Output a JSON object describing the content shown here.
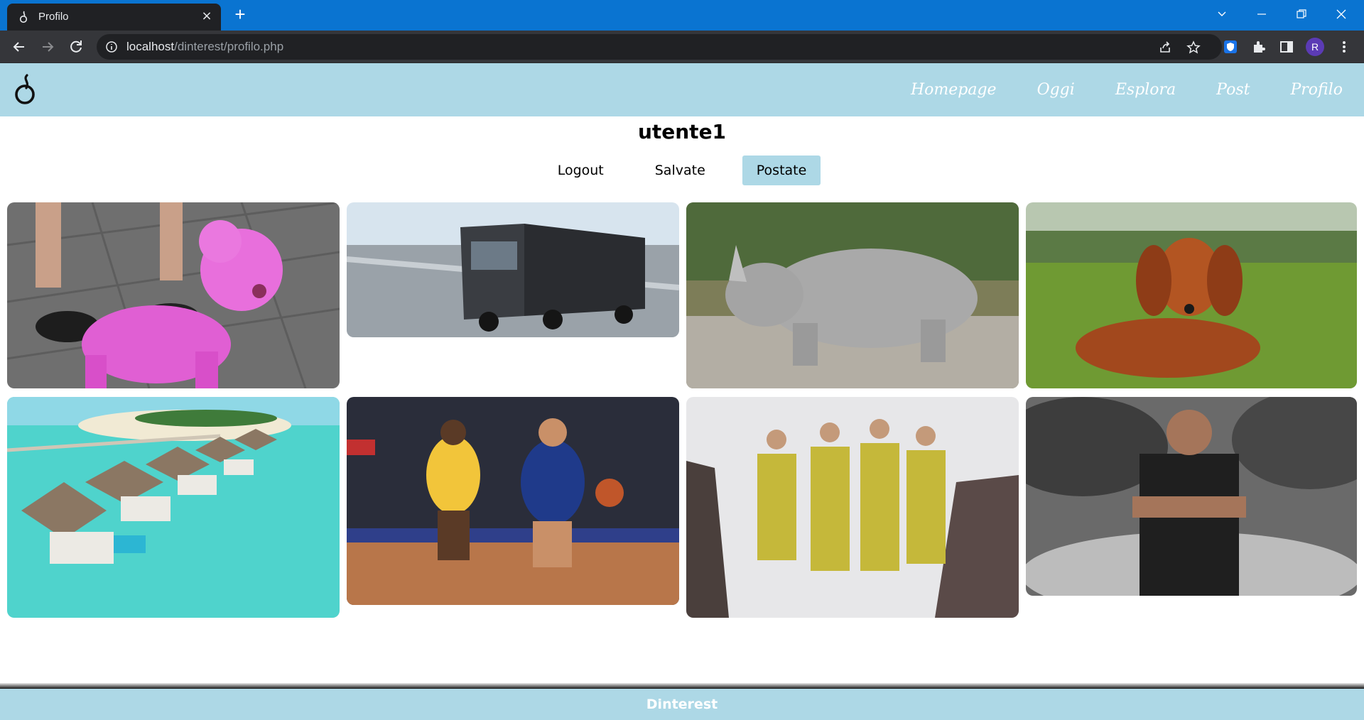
{
  "browser": {
    "tab_title": "Profilo",
    "tab_close": "×",
    "new_tab": "+",
    "url_host": "localhost",
    "url_path": "/dinterest/profilo.php",
    "profile_initial": "R",
    "accent": "#0a74d1"
  },
  "site": {
    "nav": [
      "Homepage",
      "Oggi",
      "Esplora",
      "Post",
      "Profilo"
    ],
    "username": "utente1",
    "tabs": [
      {
        "label": "Logout",
        "active": false
      },
      {
        "label": "Salvate",
        "active": false
      },
      {
        "label": "Postate",
        "active": true
      }
    ],
    "posts": [
      {
        "subject": "pink poodle on a leash"
      },
      {
        "subject": "mercedes truck on a road"
      },
      {
        "subject": "white rhinoceros"
      },
      {
        "subject": "dachshund on grass"
      },
      {
        "subject": "overwater villas on turquoise lagoon"
      },
      {
        "subject": "basketball game lakers vs warriors"
      },
      {
        "subject": "fashion runway models in yellow prints"
      },
      {
        "subject": "man with crossed arms leaning on a car"
      }
    ],
    "footer": "Dinterest",
    "header_color": "#add8e6"
  }
}
